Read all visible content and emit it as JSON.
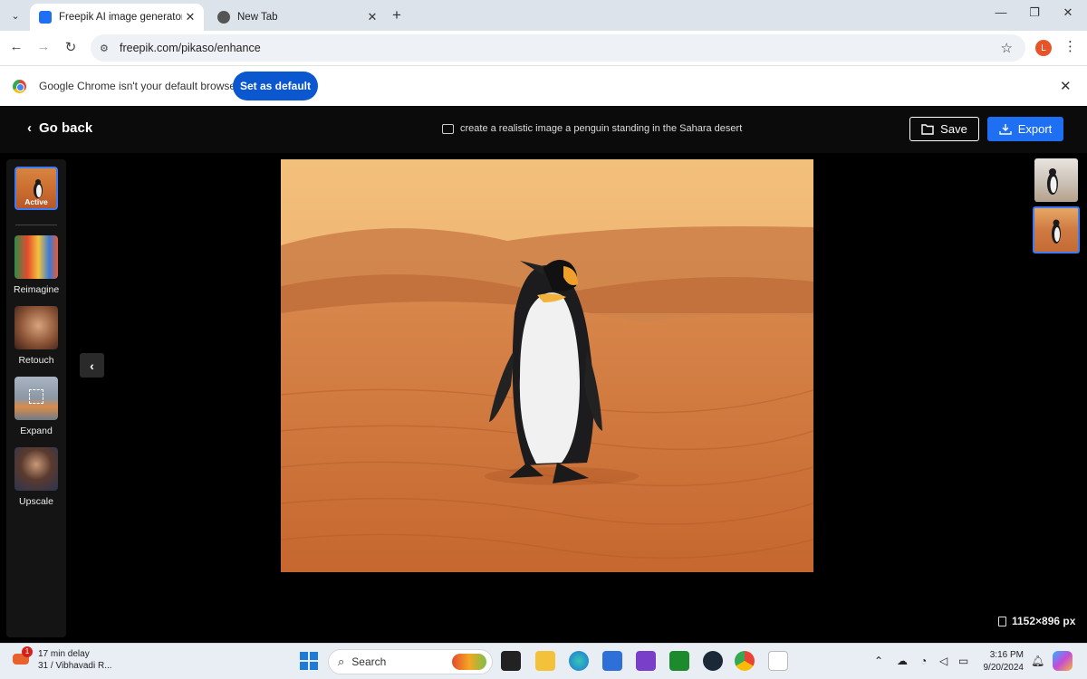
{
  "browser": {
    "tabs": [
      {
        "title": "Freepik AI image generator - Fr",
        "active": true
      },
      {
        "title": "New Tab",
        "active": false
      }
    ],
    "url": "freepik.com/pikaso/enhance",
    "profile_initial": "L",
    "infobar": {
      "message": "Google Chrome isn't your default browser",
      "button": "Set as default"
    }
  },
  "app": {
    "back_label": "Go back",
    "prompt": "create a realistic image a penguin standing in the Sahara desert",
    "save_label": "Save",
    "export_label": "Export",
    "tools": [
      {
        "label": "Active"
      },
      {
        "label": "Reimagine"
      },
      {
        "label": "Retouch"
      },
      {
        "label": "Expand"
      },
      {
        "label": "Upscale"
      }
    ],
    "dimensions": "1152×896 px",
    "colors": {
      "accent": "#1f6ff2",
      "selected_border": "#3d7bf7"
    }
  },
  "taskbar": {
    "weather_line1": "17 min delay",
    "weather_line2": "31 / Vibhavadi R...",
    "badge": "1",
    "search_placeholder": "Search",
    "time": "3:16 PM",
    "date": "9/20/2024"
  }
}
